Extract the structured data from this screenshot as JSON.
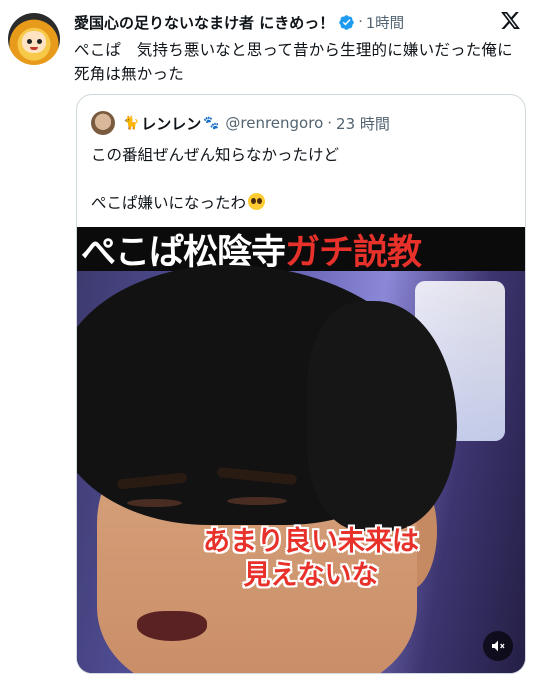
{
  "tweet": {
    "author_name": "愛国心の足りないなまけ者 にきめっ！",
    "time_separator": "·",
    "time": "1時間",
    "text": "ぺこぱ　気持ち悪いなと思って昔から生理的に嫌いだった俺に死角は無かった",
    "verified_color": "#1d9bf0",
    "x_logo": "x-logo-icon"
  },
  "quote": {
    "author_name": "レンレン",
    "emoji_before": "🐈",
    "emoji_after": "🐾",
    "handle": "@renrengoro",
    "time_separator": "·",
    "time": "23 時間",
    "text_line1": "この番組ぜんぜん知らなかったけど",
    "text_line2": "ぺこぱ嫌いになったわ",
    "text_emoji": "pleading-face-icon",
    "media": {
      "banner_white": "ぺこぱ松陰寺",
      "banner_red": "ガチ説教",
      "subtitle_line1": "あまり良い未来は",
      "subtitle_line2": "見えないな",
      "subtitle_color": "#e8312b",
      "mute_icon": "volume-mute-icon"
    }
  }
}
